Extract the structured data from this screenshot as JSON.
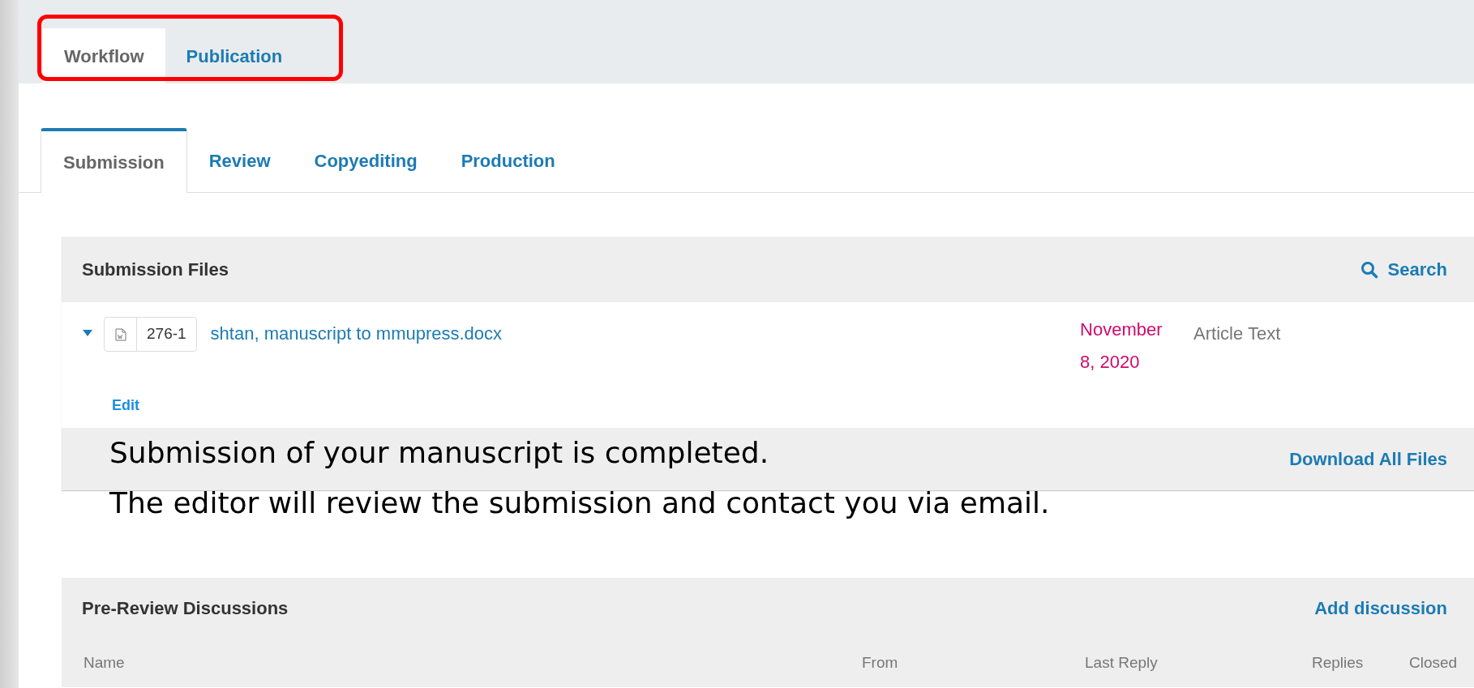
{
  "top_tabs": [
    {
      "label": "Workflow",
      "selected": true
    },
    {
      "label": "Publication",
      "selected": false
    }
  ],
  "top_tabs_highlighted": true,
  "stage_tabs": [
    {
      "label": "Submission",
      "selected": true
    },
    {
      "label": "Review",
      "selected": false
    },
    {
      "label": "Copyediting",
      "selected": false
    },
    {
      "label": "Production",
      "selected": false
    }
  ],
  "submission_files": {
    "title": "Submission Files",
    "search": "Search",
    "files": [
      {
        "expanded": true,
        "id": "276-1",
        "name": "shtan, manuscript to mmupress.docx",
        "date": "November 8, 2020",
        "type": "Article Text",
        "action": "Edit"
      }
    ],
    "footer_action": "Download All Files"
  },
  "annotation": {
    "lines": [
      "Submission of your manuscript is completed.",
      "The editor will review the submission and contact you via email."
    ]
  },
  "discussions": {
    "title": "Pre-Review Discussions",
    "action": "Add discussion",
    "columns": [
      "Name",
      "From",
      "Last Reply",
      "Replies",
      "Closed"
    ]
  }
}
